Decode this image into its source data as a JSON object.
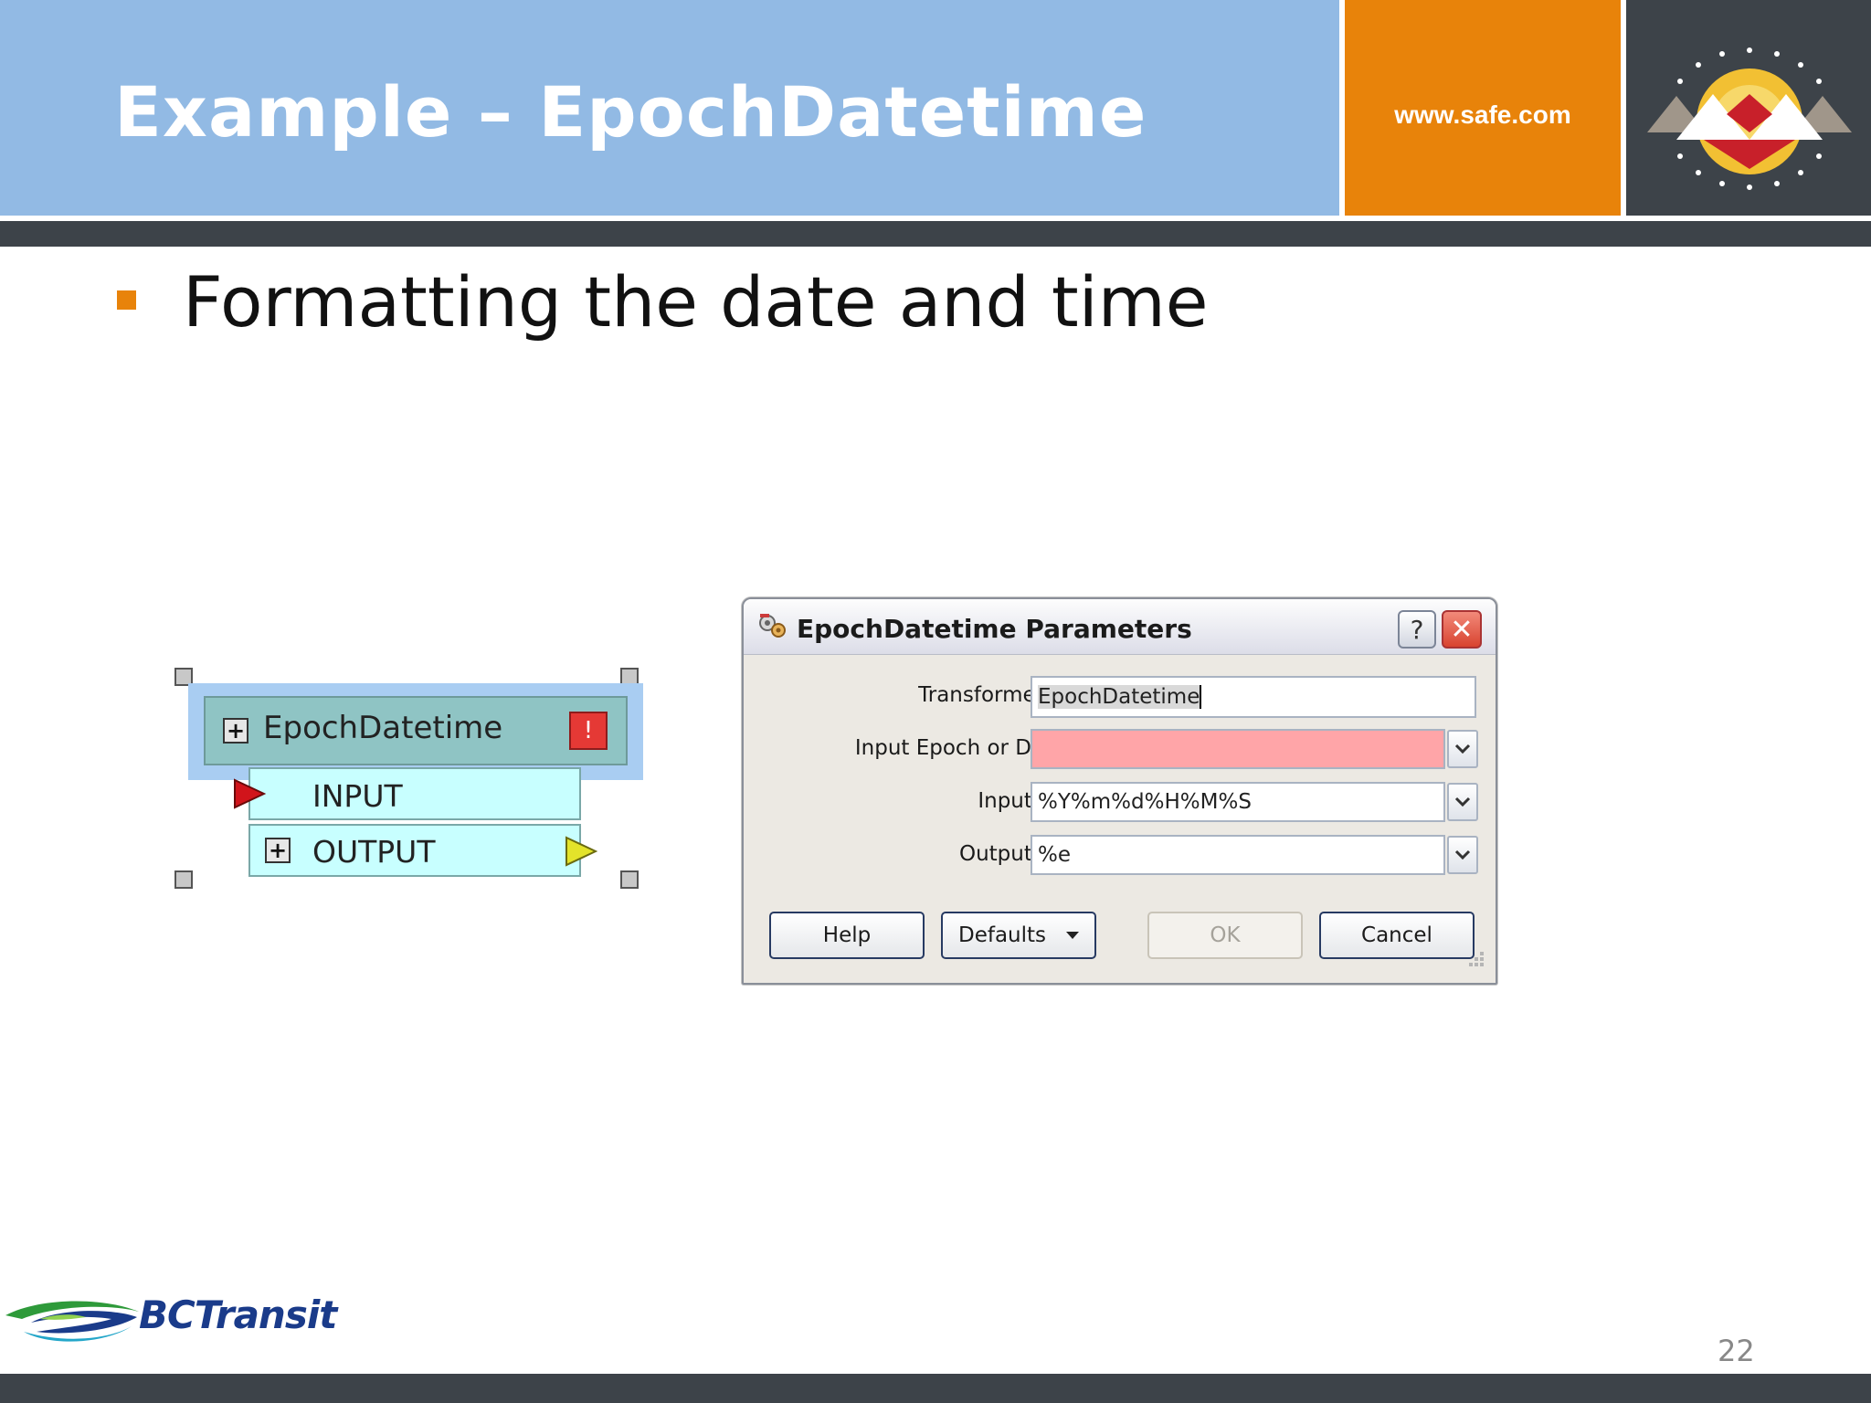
{
  "header": {
    "title": "Example – EpochDatetime",
    "url": "www.safe.com",
    "logo_icon": "fme-logo-icon"
  },
  "content": {
    "bullet": "Formatting the date and time"
  },
  "node": {
    "title": "EpochDatetime",
    "expand_symbol": "+",
    "warning_symbol": "!",
    "input_port": "INPUT",
    "output_port": "OUTPUT"
  },
  "dialog": {
    "title": "EpochDatetime Parameters",
    "help_symbol": "?",
    "close_symbol": "✕",
    "fields": {
      "transformer_name": {
        "label": "Transformer Name:",
        "value": "EpochDatetime"
      },
      "input_epoch": {
        "label": "Input Epoch or Datetime:",
        "value": "",
        "required_color": "#ffa5a8"
      },
      "input_format": {
        "label": "Input Format:",
        "value": "%Y%m%d%H%M%S"
      },
      "output_format": {
        "label": "Output Format:",
        "value": "%e"
      }
    },
    "buttons": {
      "help": "Help",
      "defaults": "Defaults",
      "ok": "OK",
      "cancel": "Cancel"
    }
  },
  "footer": {
    "brand": "BCTransit",
    "page_number": "22"
  },
  "colors": {
    "header_blue": "#92bae4",
    "accent_orange": "#e8830a",
    "dark_band": "#3d4349"
  }
}
